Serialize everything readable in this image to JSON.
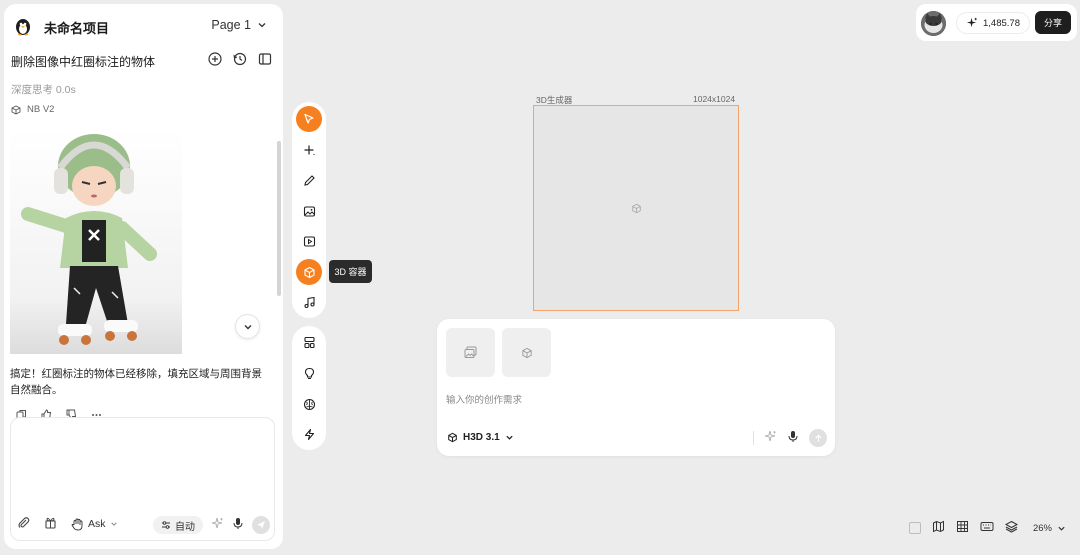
{
  "project": {
    "name": "未命名项目",
    "page_selector": "Page 1"
  },
  "chat": {
    "title": "删除图像中红圈标注的物体",
    "thinking": "深度思考 0.0s",
    "model_tag": "NB V2",
    "reply": "搞定！红圈标注的物体已经移除，填充区域与周围背景自然融合。",
    "input": {
      "placeholder": "",
      "mode_label": "Ask",
      "auto_label": "自动"
    }
  },
  "toolbar": {
    "tooltip": "3D 容器",
    "active_color": "#f6801f"
  },
  "canvas": {
    "frame_label": "3D生成器",
    "frame_size": "1024x1024",
    "frame_border_color": "#f4a46b"
  },
  "generator": {
    "prompt_placeholder": "输入你的创作需求",
    "model": "H3D 3.1"
  },
  "topbar": {
    "credits": "1,485.78",
    "share_label": "分享"
  },
  "bottombar": {
    "zoom": "26%"
  }
}
